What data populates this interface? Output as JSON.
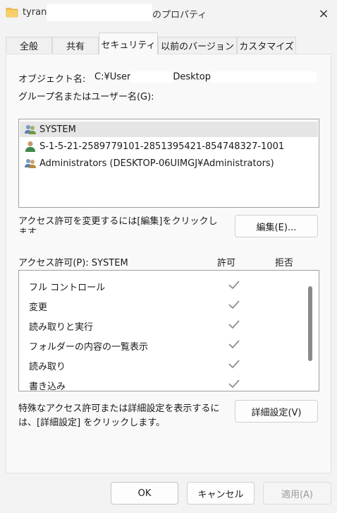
{
  "window": {
    "title_prefix": "tyranc",
    "title_suffix": "のプロパティ",
    "close_icon": "×"
  },
  "tabs": [
    {
      "label": "全般",
      "active": false
    },
    {
      "label": "共有",
      "active": false
    },
    {
      "label": "セキュリティ",
      "active": true
    },
    {
      "label": "以前のバージョン",
      "active": false
    },
    {
      "label": "カスタマイズ",
      "active": false
    }
  ],
  "security": {
    "object_name_label": "オブジェクト名:",
    "object_name_prefix": "C:¥User",
    "object_name_suffix": "Desktop",
    "group_label": "グループ名またはユーザー名(G):",
    "principals": [
      {
        "name": "SYSTEM",
        "icon": "user-group-icon",
        "selected": true
      },
      {
        "name": "S-1-5-21-2589779101-2851395421-854748327-1001",
        "icon": "user-icon",
        "selected": false
      },
      {
        "name": "Administrators (DESKTOP-06UIMGJ¥Administrators)",
        "icon": "user-group-icon",
        "selected": false
      }
    ],
    "change_text": "アクセス許可を変更するには[編集]をクリックします。",
    "edit_button": "編集(E)...",
    "permissions_label": "アクセス許可(P): SYSTEM",
    "allow_header": "許可",
    "deny_header": "拒否",
    "permissions": [
      {
        "name": "フル コントロール",
        "allow": true,
        "deny": false
      },
      {
        "name": "変更",
        "allow": true,
        "deny": false
      },
      {
        "name": "読み取りと実行",
        "allow": true,
        "deny": false
      },
      {
        "name": "フォルダーの内容の一覧表示",
        "allow": true,
        "deny": false
      },
      {
        "name": "読み取り",
        "allow": true,
        "deny": false
      },
      {
        "name": "書き込み",
        "allow": true,
        "deny": false
      }
    ],
    "advanced_text": "特殊なアクセス許可または詳細設定を表示するには、[詳細設定] をクリックします。",
    "advanced_button": "詳細設定(V)"
  },
  "footer": {
    "ok": "OK",
    "cancel": "キャンセル",
    "apply": "適用(A)"
  },
  "colors": {
    "folder": "#f2c14e",
    "check": "#8f8f8f",
    "selection": "#e5e5e5"
  }
}
